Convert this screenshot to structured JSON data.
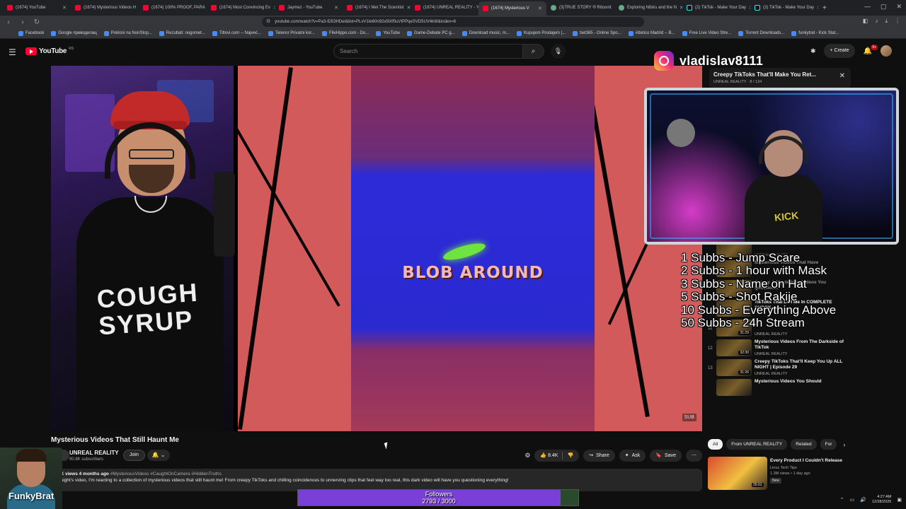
{
  "browser": {
    "tabs": [
      {
        "label": "(1674) YouTube",
        "active": false
      },
      {
        "label": "(1674) Mysterious Videos H",
        "active": false
      },
      {
        "label": "(1674) 100% PROOF, PARA",
        "active": false
      },
      {
        "label": "(1674) Most Convincing Ev",
        "active": false
      },
      {
        "label": "Jaymez - YouTube",
        "active": false
      },
      {
        "label": "(1674) I Met The Scientist",
        "active": false
      },
      {
        "label": "(1674) UNREAL REALITY - Y",
        "active": false
      },
      {
        "label": "(1674) Mysterious V",
        "active": true
      },
      {
        "label": "(3)TRUE STORY ® Ritosnit",
        "active": false
      },
      {
        "label": "Exploring Nibiru and the N",
        "active": false
      },
      {
        "label": "(2) TikTok - Make Your Day",
        "active": false
      },
      {
        "label": "(2) TikTok - Make Your Day",
        "active": false
      }
    ],
    "url": "youtube.com/watch?v=Pa3-lD53HDeI&list=PLvV1Ie60n92x5lXf0uVtPPqeSVD5UV4kW&index=8",
    "bookmarks": [
      "Facebook",
      "Google преводилац",
      "Pokloni na NonStop...",
      "Rezultati: nogomet...",
      "Titlovi.com -- Najveć...",
      "Telenor Privatni kor...",
      "FileHippo.com - Do...",
      "YouTube",
      "Game-Debate PC g...",
      "Download music, m...",
      "Kupujem Prodajem |...",
      "bet365 - Online Spo...",
      "Atletico Madrid -- B...",
      "Free Live Video Stre...",
      "Torrent Downloads...",
      "funkytrat - Kick Stat..."
    ]
  },
  "youtube": {
    "logo_text": "YouTube",
    "region": "RS",
    "search_placeholder": "Search",
    "create_label": "Create",
    "notif_count": "9+"
  },
  "video": {
    "caption": "BLOB AROUND",
    "shirt_text": "COUGH SYRUP",
    "watermark": "SUB",
    "title": "Mysterious Videos That Still Haunt Me",
    "channel": "UNREAL REALITY",
    "subscribers": "90.8K subscribers",
    "join_label": "Join",
    "likes": "8.4K",
    "share_label": "Share",
    "ask_label": "Ask",
    "save_label": "Save",
    "views_line": "7K views  4 months ago",
    "tags": "#MysteriousVideos #CaughtOnCamera #HiddenTruths",
    "description": "onight's video, I'm reacting to a collection of mysterious videos that still haunt me! From creepy TikToks and chilling coincidences to unnerving clips that feel way too real, this dark video will have you questioning everything!"
  },
  "mini_player": {
    "title": "Creepy TikToks That'll Make You Ret...",
    "subtitle": "UNREAL REALITY · 8 / 134"
  },
  "overlay": {
    "instagram_handle": "vladislav8111",
    "goals": [
      "1 Subbs - Jump Scare",
      "2 Subbs - 1 hour with Mask",
      "3 Subbs - Name on Hat",
      "5 Subbs - Shot Rakije",
      "10 Subbs - Everything Above",
      "50 Subbs - 24h Stream"
    ],
    "webcam_shirt": "KICK",
    "streamer_name": "FunkyBrat",
    "followers_label": "Followers",
    "followers_count": "2793 / 3000",
    "followers_progress": 0.931
  },
  "recommendations": [
    {
      "num": "",
      "title": "",
      "channel": "UNREAL REALITY",
      "duration": "",
      "dim": true
    },
    {
      "num": "",
      "title": "Mysterious Videos That Have",
      "channel": "",
      "duration": "",
      "dim": true
    },
    {
      "num": "",
      "title": "Creepy & Mysterious Videos You Question...",
      "channel": "",
      "duration": "",
      "dim": true
    },
    {
      "num": "",
      "title": "TikToks That Left Me In COMPLETE SHOCK",
      "channel": "",
      "duration": "",
      "dim": false
    },
    {
      "num": "11",
      "title": "",
      "channel": "UNREAL REALITY",
      "duration": "31:29",
      "dim": false
    },
    {
      "num": "12",
      "title": "Mysterious Videos From The Darkside of TikTok",
      "channel": "UNREAL REALITY",
      "duration": "32:30",
      "dim": false
    },
    {
      "num": "13",
      "title": "Creepy TikToks That'll Keep You Up ALL NIGHT | Episode 29",
      "channel": "UNREAL REALITY",
      "duration": "31:26",
      "dim": false
    },
    {
      "num": "",
      "title": "Mysterious Videos You Should",
      "channel": "",
      "duration": "",
      "dim": false
    }
  ],
  "chips": [
    "All",
    "From UNREAL REALITY",
    "Related",
    "For"
  ],
  "bottom_rec": {
    "title": "Every Product I Couldn't Release",
    "channel": "Linus Tech Tips",
    "meta": "1.3M views • 1 day ago",
    "badge": "New",
    "duration": "25:01"
  },
  "tray": {
    "time": "4:27 AM",
    "date": "12/28/2025"
  }
}
